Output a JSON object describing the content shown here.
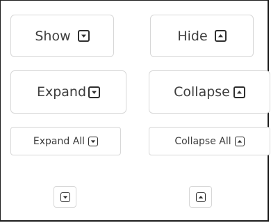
{
  "buttons": {
    "show": {
      "label": "Show",
      "icon": "caret-down-square-icon"
    },
    "hide": {
      "label": "Hide",
      "icon": "caret-up-square-icon"
    },
    "expand": {
      "label": "Expand",
      "icon": "caret-down-square-icon"
    },
    "collapse": {
      "label": "Collapse",
      "icon": "caret-up-square-icon"
    },
    "expand_all": {
      "label": "Expand All",
      "icon": "caret-down-square-icon"
    },
    "collapse_all": {
      "label": "Collapse All",
      "icon": "caret-up-square-icon"
    },
    "expand_icon_only": {
      "icon": "caret-down-square-icon"
    },
    "collapse_icon_only": {
      "icon": "caret-up-square-icon"
    }
  },
  "colors": {
    "text": "#3e3e3e",
    "icon": "#2f2f2f",
    "button_border": "#d7d7d7",
    "frame_border": "#1e1e1e",
    "background": "#ffffff"
  }
}
